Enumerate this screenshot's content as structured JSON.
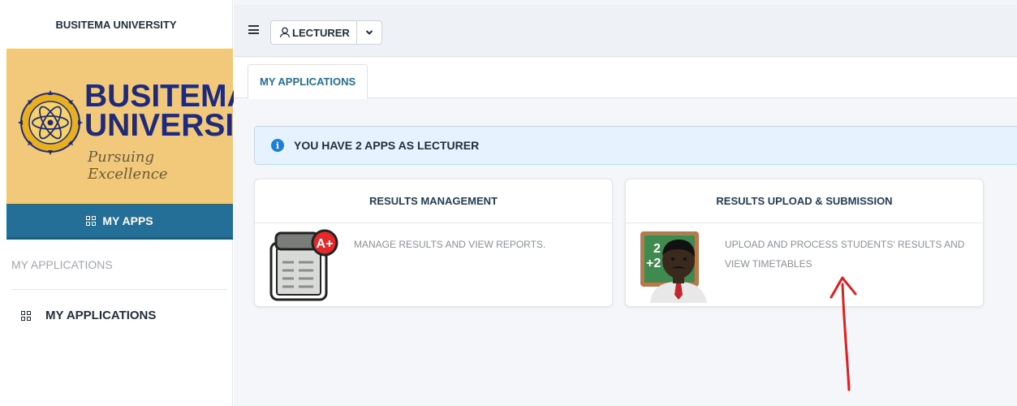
{
  "sidebar": {
    "title": "BUSITEMA UNIVERSITY",
    "logo": {
      "line1": "BUSITEMA",
      "line2": "UNIVERSITY",
      "tagline": "Pursuing Excellence"
    },
    "my_apps_label": "MY APPS",
    "section_label": "MY APPLICATIONS",
    "items": [
      {
        "label": "MY APPLICATIONS"
      }
    ]
  },
  "topbar": {
    "role_label": "LECTURER"
  },
  "tabs": [
    {
      "label": "MY APPLICATIONS"
    }
  ],
  "alert": {
    "text": "YOU HAVE 2 APPS AS LECTURER"
  },
  "apps": [
    {
      "title": "RESULTS MANAGEMENT",
      "description": "MANAGE RESULTS AND VIEW REPORTS.",
      "icon": "clipboard-grade-icon"
    },
    {
      "title": "RESULTS UPLOAD & SUBMISSION",
      "description": "UPLOAD AND PROCESS STUDENTS' RESULTS AND VIEW TIMETABLES",
      "icon": "teacher-icon"
    }
  ],
  "colors": {
    "primary": "#246f97",
    "logo_bg": "#f2c97a",
    "alert_bg": "#e6f2fd",
    "annotation": "#e02020"
  }
}
